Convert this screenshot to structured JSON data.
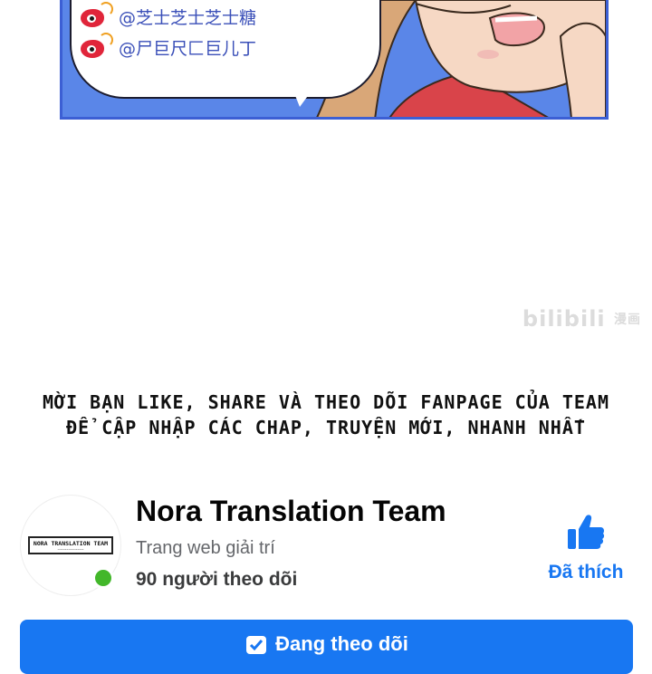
{
  "comic": {
    "social_handles": [
      {
        "icon": "weibo-icon",
        "handle": "@芝士芝士芝士糖"
      },
      {
        "icon": "weibo-icon",
        "handle": "@尸巨尺匚巨儿丁"
      }
    ],
    "watermark_main": "bilibili",
    "watermark_side": "漫画"
  },
  "cta": {
    "line1": "Mời bạn like, share và theo dõi fanpage của team",
    "line2": "để cập nhập các chap, truyện mới, nhanh nhất"
  },
  "fb_page": {
    "logo_text": "NORA TRANSLATION TEAM",
    "name": "Nora Translation Team",
    "category": "Trang web giải trí",
    "followers": "90 người theo dõi",
    "like_label": "Đã thích",
    "follow_label": "Đang theo dõi",
    "colors": {
      "brand": "#1877f2",
      "online": "#42b72a"
    }
  }
}
